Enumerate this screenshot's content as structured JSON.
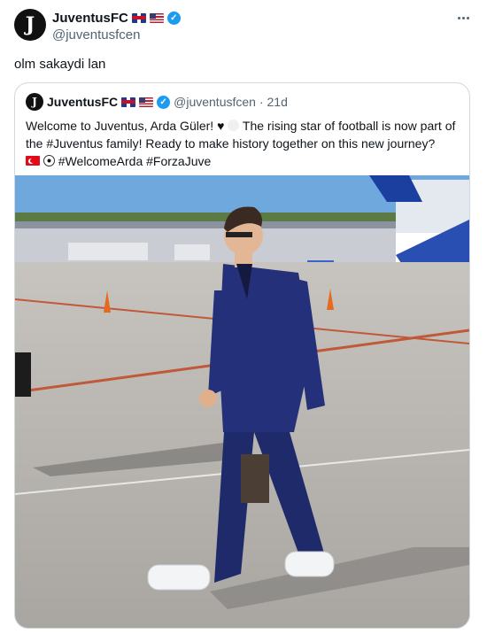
{
  "tweet": {
    "author": {
      "name": "JuventusFC",
      "handle": "@juventusfcen",
      "flags": [
        "uk-flag",
        "us-flag"
      ],
      "verified": true
    },
    "text": "olm sakaydi lan",
    "more_icon": "more-icon"
  },
  "quote": {
    "author": {
      "name": "JuventusFC",
      "handle": "@juventusfcen",
      "time": "· 21d"
    },
    "line1_a": "Welcome to Juventus, Arda Güler!",
    "line1_b": "The rising star of football is now part",
    "line2": "of the #Juventus family! Ready to make history together on this new journey?",
    "line3": "#WelcomeArda #ForzaJuve",
    "image_alt": "photo of player in navy suit walking on airport tarmac"
  },
  "colors": {
    "verified": "#1d9bf0",
    "secondary": "#536471",
    "border": "#cfd9de",
    "suit": "#1f2a6b"
  }
}
